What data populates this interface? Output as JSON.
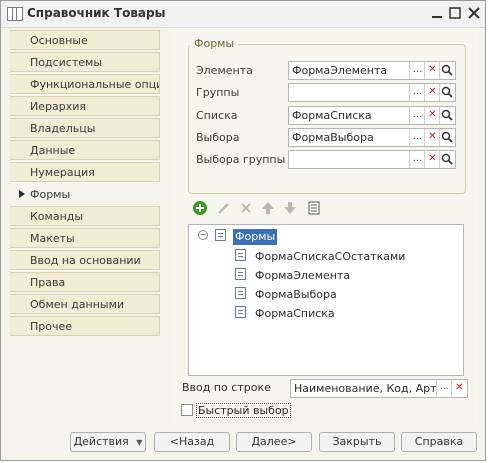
{
  "window": {
    "title": "Справочник Товары",
    "icon": "table-icon"
  },
  "sidebar": {
    "items": [
      {
        "label": "Основные",
        "active": false
      },
      {
        "label": "Подсистемы",
        "active": false
      },
      {
        "label": "Функциональные опции",
        "active": false
      },
      {
        "label": "Иерархия",
        "active": false
      },
      {
        "label": "Владельцы",
        "active": false
      },
      {
        "label": "Данные",
        "active": false
      },
      {
        "label": "Нумерация",
        "active": false
      },
      {
        "label": "Формы",
        "active": true
      },
      {
        "label": "Команды",
        "active": false
      },
      {
        "label": "Макеты",
        "active": false
      },
      {
        "label": "Ввод на основании",
        "active": false
      },
      {
        "label": "Права",
        "active": false
      },
      {
        "label": "Обмен данными",
        "active": false
      },
      {
        "label": "Прочее",
        "active": false
      }
    ]
  },
  "forms_group": {
    "title": "Формы",
    "fields": [
      {
        "label": "Элемента",
        "value": "ФормаЭлемента"
      },
      {
        "label": "Группы",
        "value": ""
      },
      {
        "label": "Списка",
        "value": "ФормаСписка"
      },
      {
        "label": "Выбора",
        "value": "ФормаВыбора"
      },
      {
        "label": "Выбора группы",
        "value": ""
      }
    ],
    "field_buttons": {
      "select": "...",
      "clear": "✕",
      "open": "🔍"
    }
  },
  "toolbar": {
    "icons": [
      "add-icon",
      "edit-icon",
      "delete-icon",
      "move-up-icon",
      "move-down-icon",
      "list-icon"
    ]
  },
  "tree": {
    "root": "Формы",
    "children": [
      "ФормаСпискаСОстатками",
      "ФормаЭлемента",
      "ФормаВыбора",
      "ФормаСписка"
    ]
  },
  "quick_input": {
    "label": "Ввод по строке",
    "value": "Наименование, Код, Артикул"
  },
  "fast_select": {
    "label": "Быстрый выбор",
    "checked": false
  },
  "buttons": {
    "actions": "Действия",
    "back": "<Назад",
    "next": "Далее>",
    "close": "Закрыть",
    "help": "Справка"
  },
  "colors": {
    "accent": "#3b6fb6",
    "tab_bg": "#f1ecd4",
    "add_green": "#3a9a2a"
  }
}
